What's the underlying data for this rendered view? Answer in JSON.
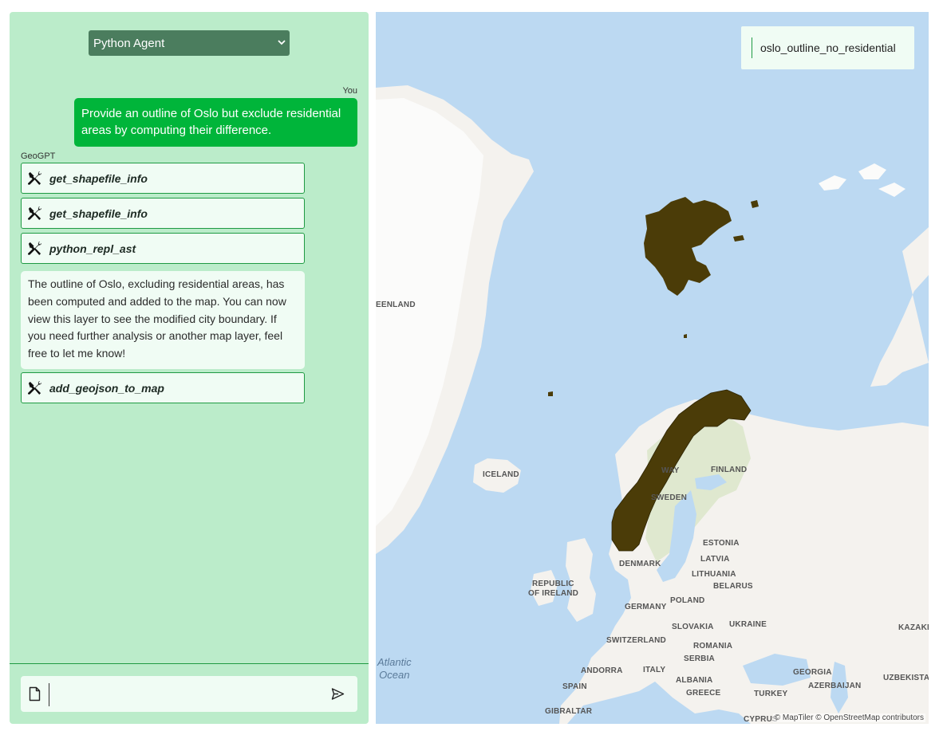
{
  "chat": {
    "agent_select": {
      "value": "Python Agent"
    },
    "user_label": "You",
    "user_message": "Provide an outline of Oslo but exclude residential areas by computing their difference.",
    "bot_label": "GeoGPT",
    "tools": [
      {
        "name": "get_shapefile_info",
        "icon": "tools-icon"
      },
      {
        "name": "get_shapefile_info",
        "icon": "tools-icon"
      },
      {
        "name": "python_repl_ast",
        "icon": "tools-icon"
      },
      {
        "name": "add_geojson_to_map",
        "icon": "tools-icon"
      }
    ],
    "bot_message": "The outline of Oslo, excluding residential areas, has been computed and added to the map. You can now view this layer to see the modified city boundary. If you need further analysis or another map layer, feel free to let me know!",
    "input": {
      "value": "",
      "placeholder": ""
    }
  },
  "map": {
    "layer_name": "oslo_outline_no_residential",
    "labels": {
      "greenland": "EENLAND",
      "iceland": "ICELAND",
      "norway": "WAY",
      "finland": "FINLAND",
      "sweden": "SWEDEN",
      "estonia": "ESTONIA",
      "latvia": "LATVIA",
      "lithuania": "LITHUANIA",
      "belarus": "BELARUS",
      "denmark": "DENMARK",
      "ireland_1": "REPUBLIC",
      "ireland_2": "OF IRELAND",
      "poland": "POLAND",
      "germany": "GERMANY",
      "slovakia": "SLOVAKIA",
      "ukraine": "UKRAINE",
      "kazakh": "KAZAKH",
      "switzerland": "SWITZERLAND",
      "romania": "ROMANIA",
      "serbia": "SERBIA",
      "andorra": "ANDORRA",
      "italy": "ITALY",
      "albania": "ALBANIA",
      "georgia": "GEORGIA",
      "spain": "SPAIN",
      "greece": "GREECE",
      "azerbaijan": "AZERBAIJAN",
      "uzbekistan": "UZBEKISTAN",
      "turkey": "TURKEY",
      "gibraltar": "GIBRALTAR",
      "cyprus": "CYPRUS"
    },
    "ocean": "Atlantic\nOcean",
    "attribution": "© MapTiler © OpenStreetMap contributors",
    "colors": {
      "water": "#bcd9f2",
      "land": "#f4f2ee",
      "ice": "#fbfbfa",
      "forest": "#dfe8cf",
      "overlay": "#4b3c08"
    }
  }
}
